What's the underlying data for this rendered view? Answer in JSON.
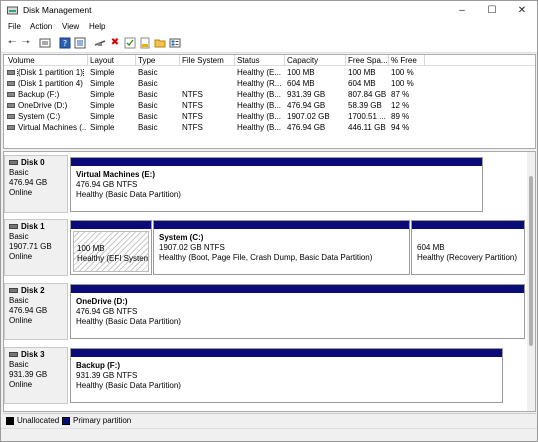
{
  "window": {
    "title": "Disk Management"
  },
  "menu": [
    "File",
    "Action",
    "View",
    "Help"
  ],
  "volume_table": {
    "headers": [
      "Volume",
      "Layout",
      "Type",
      "File System",
      "Status",
      "Capacity",
      "Free Spa...",
      "% Free"
    ],
    "rows": [
      [
        "(Disk 1 partition 1)",
        "Simple",
        "Basic",
        "",
        "Healthy (E...",
        "100 MB",
        "100 MB",
        "100 %"
      ],
      [
        "(Disk 1 partition 4)",
        "Simple",
        "Basic",
        "",
        "Healthy (R...",
        "604 MB",
        "604 MB",
        "100 %"
      ],
      [
        "Backup (F:)",
        "Simple",
        "Basic",
        "NTFS",
        "Healthy (B...",
        "931.39 GB",
        "807.84 GB",
        "87 %"
      ],
      [
        "OneDrive (D:)",
        "Simple",
        "Basic",
        "NTFS",
        "Healthy (B...",
        "476.94 GB",
        "58.39 GB",
        "12 %"
      ],
      [
        "System (C:)",
        "Simple",
        "Basic",
        "NTFS",
        "Healthy (B...",
        "1907.02 GB",
        "1700.51 ...",
        "89 %"
      ],
      [
        "Virtual Machines (...",
        "Simple",
        "Basic",
        "NTFS",
        "Healthy (B...",
        "476.94 GB",
        "446.11 GB",
        "94 %"
      ]
    ]
  },
  "disks": [
    {
      "name": "Disk 0",
      "type": "Basic",
      "size": "476.94 GB",
      "status": "Online",
      "partitions": [
        {
          "name": "Virtual Machines  (E:)",
          "size": "476.94 GB NTFS",
          "status": "Healthy (Basic Data Partition)"
        }
      ]
    },
    {
      "name": "Disk 1",
      "type": "Basic",
      "size": "1907.71 GB",
      "status": "Online",
      "partitions": [
        {
          "name": "",
          "size": "100 MB",
          "status": "Healthy (EFI System P"
        },
        {
          "name": "System  (C:)",
          "size": "1907.02 GB NTFS",
          "status": "Healthy (Boot, Page File, Crash Dump, Basic Data Partition)"
        },
        {
          "name": "",
          "size": "604 MB",
          "status": "Healthy (Recovery Partition)"
        }
      ]
    },
    {
      "name": "Disk 2",
      "type": "Basic",
      "size": "476.94 GB",
      "status": "Online",
      "partitions": [
        {
          "name": "OneDrive  (D:)",
          "size": "476.94 GB NTFS",
          "status": "Healthy (Basic Data Partition)"
        }
      ]
    },
    {
      "name": "Disk 3",
      "type": "Basic",
      "size": "931.39 GB",
      "status": "Online",
      "partitions": [
        {
          "name": "Backup  (F:)",
          "size": "931.39 GB NTFS",
          "status": "Healthy (Basic Data Partition)"
        }
      ]
    }
  ],
  "legend": {
    "unallocated": "Unallocated",
    "primary": "Primary partition",
    "unallocated_color": "#000000",
    "primary_color": "#0a0a78"
  },
  "icons": [
    "disk-management-icon",
    "back-icon",
    "forward-icon",
    "properties-icon",
    "help-icon",
    "connect-icon",
    "delete-icon",
    "check-icon",
    "new-volume-icon",
    "folder-icon",
    "list-view-icon"
  ]
}
